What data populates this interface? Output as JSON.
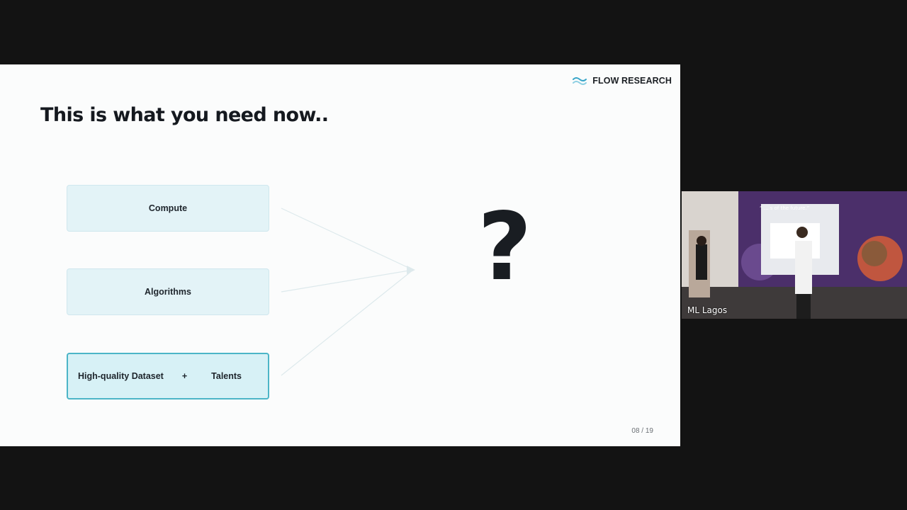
{
  "slide": {
    "brand": "FLOW RESEARCH",
    "title": "This is what you need now..",
    "cards": {
      "compute": "Compute",
      "algorithms": "Algorithms",
      "dataset": "High-quality Dataset",
      "plus": "+",
      "talents": "Talents"
    },
    "question_mark": "?",
    "page_number": "08 / 19"
  },
  "video": {
    "participant_name": "ML Lagos",
    "mural_text": "“ ... s of the future.”"
  },
  "colors": {
    "background": "#131313",
    "slide_bg": "#fbfcfc",
    "card_fill": "#e3f3f7",
    "highlight_border": "#4cb5c7",
    "brand_logo": "#3aa6c9"
  }
}
